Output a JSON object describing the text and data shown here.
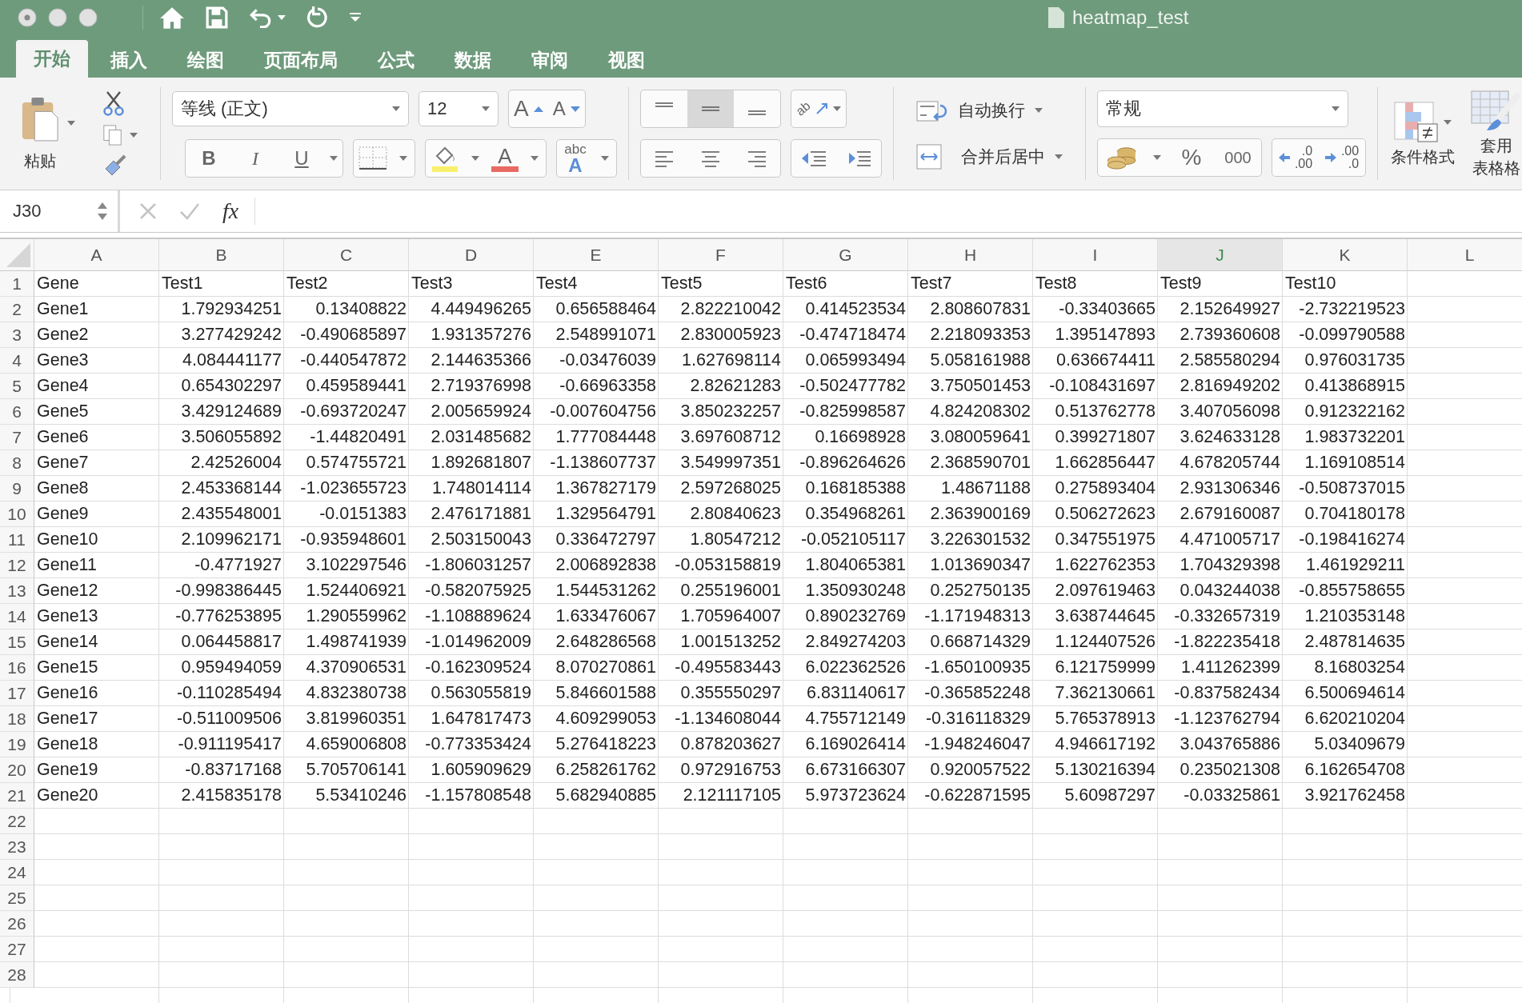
{
  "window": {
    "title": "heatmap_test"
  },
  "tabs": [
    {
      "label": "开始",
      "selected": true
    },
    {
      "label": "插入",
      "selected": false
    },
    {
      "label": "绘图",
      "selected": false
    },
    {
      "label": "页面布局",
      "selected": false
    },
    {
      "label": "公式",
      "selected": false
    },
    {
      "label": "数据",
      "selected": false
    },
    {
      "label": "审阅",
      "selected": false
    },
    {
      "label": "视图",
      "selected": false
    }
  ],
  "ribbon": {
    "paste_label": "粘贴",
    "font": {
      "name": "等线 (正文)",
      "size": "12",
      "grow": "A",
      "shrink": "A",
      "bold": "B",
      "italic": "I",
      "underline": "U",
      "font_color": "A",
      "phonetic_top": "abc",
      "phonetic_bottom": "A"
    },
    "vertical_align": [
      {
        "kind": "top",
        "selected": false
      },
      {
        "kind": "middle",
        "selected": true
      },
      {
        "kind": "bottom",
        "selected": false
      }
    ],
    "orientation": "ab",
    "horizontal_align": [
      {
        "kind": "left",
        "selected": false
      },
      {
        "kind": "center",
        "selected": false
      },
      {
        "kind": "right",
        "selected": false
      }
    ],
    "wrap_text": "自动换行",
    "merge_center": "合并后居中",
    "number_format": "常规",
    "percent": "%",
    "thousands": "000",
    "increase_decimal": [
      ".0",
      ".00"
    ],
    "decrease_decimal": [
      ".00",
      ".0"
    ],
    "conditional_format": "条件格式",
    "table_format": [
      "套用",
      "表格格"
    ]
  },
  "formula_bar": {
    "name_box": "J30",
    "fx": "fx"
  },
  "sheet": {
    "columns": [
      {
        "label": "A",
        "selected": false
      },
      {
        "label": "B",
        "selected": false
      },
      {
        "label": "C",
        "selected": false
      },
      {
        "label": "D",
        "selected": false
      },
      {
        "label": "E",
        "selected": false
      },
      {
        "label": "F",
        "selected": false
      },
      {
        "label": "G",
        "selected": false
      },
      {
        "label": "H",
        "selected": false
      },
      {
        "label": "I",
        "selected": false
      },
      {
        "label": "J",
        "selected": true
      },
      {
        "label": "K",
        "selected": false
      },
      {
        "label": "L",
        "selected": false
      }
    ],
    "rows": [
      {
        "number": "1",
        "cells": [
          "Gene",
          "Test1",
          "Test2",
          "Test3",
          "Test4",
          "Test5",
          "Test6",
          "Test7",
          "Test8",
          "Test9",
          "Test10"
        ]
      },
      {
        "number": "2",
        "cells": [
          "Gene1",
          "1.792934251",
          "0.13408822",
          "4.449496265",
          "0.656588464",
          "2.822210042",
          "0.414523534",
          "2.808607831",
          "-0.33403665",
          "2.152649927",
          "-2.732219523"
        ]
      },
      {
        "number": "3",
        "cells": [
          "Gene2",
          "3.277429242",
          "-0.490685897",
          "1.931357276",
          "2.548991071",
          "2.830005923",
          "-0.474718474",
          "2.218093353",
          "1.395147893",
          "2.739360608",
          "-0.099790588"
        ]
      },
      {
        "number": "4",
        "cells": [
          "Gene3",
          "4.084441177",
          "-0.440547872",
          "2.144635366",
          "-0.03476039",
          "1.627698114",
          "0.065993494",
          "5.058161988",
          "0.636674411",
          "2.585580294",
          "0.976031735"
        ]
      },
      {
        "number": "5",
        "cells": [
          "Gene4",
          "0.654302297",
          "0.459589441",
          "2.719376998",
          "-0.66963358",
          "2.82621283",
          "-0.502477782",
          "3.750501453",
          "-0.108431697",
          "2.816949202",
          "0.413868915"
        ]
      },
      {
        "number": "6",
        "cells": [
          "Gene5",
          "3.429124689",
          "-0.693720247",
          "2.005659924",
          "-0.007604756",
          "3.850232257",
          "-0.825998587",
          "4.824208302",
          "0.513762778",
          "3.407056098",
          "0.912322162"
        ]
      },
      {
        "number": "7",
        "cells": [
          "Gene6",
          "3.506055892",
          "-1.44820491",
          "2.031485682",
          "1.777084448",
          "3.697608712",
          "0.16698928",
          "3.080059641",
          "0.399271807",
          "3.624633128",
          "1.983732201"
        ]
      },
      {
        "number": "8",
        "cells": [
          "Gene7",
          "2.42526004",
          "0.574755721",
          "1.892681807",
          "-1.138607737",
          "3.549997351",
          "-0.896264626",
          "2.368590701",
          "1.662856447",
          "4.678205744",
          "1.169108514"
        ]
      },
      {
        "number": "9",
        "cells": [
          "Gene8",
          "2.453368144",
          "-1.023655723",
          "1.748014114",
          "1.367827179",
          "2.597268025",
          "0.168185388",
          "1.48671188",
          "0.275893404",
          "2.931306346",
          "-0.508737015"
        ]
      },
      {
        "number": "10",
        "cells": [
          "Gene9",
          "2.435548001",
          "-0.0151383",
          "2.476171881",
          "1.329564791",
          "2.80840623",
          "0.354968261",
          "2.363900169",
          "0.506272623",
          "2.679160087",
          "0.704180178"
        ]
      },
      {
        "number": "11",
        "cells": [
          "Gene10",
          "2.109962171",
          "-0.935948601",
          "2.503150043",
          "0.336472797",
          "1.80547212",
          "-0.052105117",
          "3.226301532",
          "0.347551975",
          "4.471005717",
          "-0.198416274"
        ]
      },
      {
        "number": "12",
        "cells": [
          "Gene11",
          "-0.4771927",
          "3.102297546",
          "-1.806031257",
          "2.006892838",
          "-0.053158819",
          "1.804065381",
          "1.013690347",
          "1.622762353",
          "1.704329398",
          "1.461929211"
        ]
      },
      {
        "number": "13",
        "cells": [
          "Gene12",
          "-0.998386445",
          "1.524406921",
          "-0.582075925",
          "1.544531262",
          "0.255196001",
          "1.350930248",
          "0.252750135",
          "2.097619463",
          "0.043244038",
          "-0.855758655"
        ]
      },
      {
        "number": "14",
        "cells": [
          "Gene13",
          "-0.776253895",
          "1.290559962",
          "-1.108889624",
          "1.633476067",
          "1.705964007",
          "0.890232769",
          "-1.171948313",
          "3.638744645",
          "-0.332657319",
          "1.210353148"
        ]
      },
      {
        "number": "15",
        "cells": [
          "Gene14",
          "0.064458817",
          "1.498741939",
          "-1.014962009",
          "2.648286568",
          "1.001513252",
          "2.849274203",
          "0.668714329",
          "1.124407526",
          "-1.822235418",
          "2.487814635"
        ]
      },
      {
        "number": "16",
        "cells": [
          "Gene15",
          "0.959494059",
          "4.370906531",
          "-0.162309524",
          "8.070270861",
          "-0.495583443",
          "6.022362526",
          "-1.650100935",
          "6.121759999",
          "1.411262399",
          "8.16803254"
        ]
      },
      {
        "number": "17",
        "cells": [
          "Gene16",
          "-0.110285494",
          "4.832380738",
          "0.563055819",
          "5.846601588",
          "0.355550297",
          "6.831140617",
          "-0.365852248",
          "7.362130661",
          "-0.837582434",
          "6.500694614"
        ]
      },
      {
        "number": "18",
        "cells": [
          "Gene17",
          "-0.511009506",
          "3.819960351",
          "1.647817473",
          "4.609299053",
          "-1.134608044",
          "4.755712149",
          "-0.316118329",
          "5.765378913",
          "-1.123762794",
          "6.620210204"
        ]
      },
      {
        "number": "19",
        "cells": [
          "Gene18",
          "-0.911195417",
          "4.659006808",
          "-0.773353424",
          "5.276418223",
          "0.878203627",
          "6.169026414",
          "-1.948246047",
          "4.946617192",
          "3.043765886",
          "5.03409679"
        ]
      },
      {
        "number": "20",
        "cells": [
          "Gene19",
          "-0.83717168",
          "5.705706141",
          "1.605909629",
          "6.258261762",
          "0.972916753",
          "6.673166307",
          "0.920057522",
          "5.130216394",
          "0.235021308",
          "6.162654708"
        ]
      },
      {
        "number": "21",
        "cells": [
          "Gene20",
          "2.415835178",
          "5.53410246",
          "-1.157808548",
          "5.682940885",
          "2.121117105",
          "5.973723624",
          "-0.622871595",
          "5.60987297",
          "-0.03325861",
          "3.921762458"
        ]
      },
      {
        "number": "22",
        "cells": []
      },
      {
        "number": "23",
        "cells": []
      },
      {
        "number": "24",
        "cells": []
      },
      {
        "number": "25",
        "cells": []
      },
      {
        "number": "26",
        "cells": []
      },
      {
        "number": "27",
        "cells": []
      },
      {
        "number": "28",
        "cells": []
      }
    ]
  }
}
